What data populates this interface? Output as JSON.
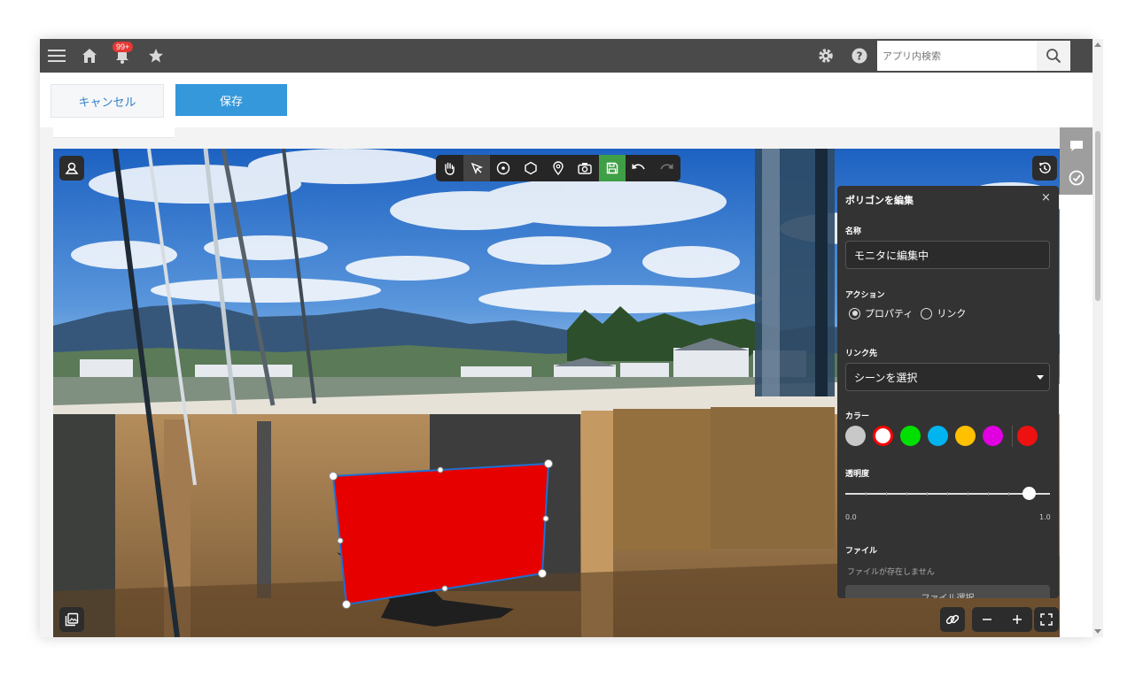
{
  "header": {
    "notification_badge": "99+",
    "search": {
      "placeholder": "アプリ内検索",
      "value": ""
    }
  },
  "actions": {
    "cancel_label": "キャンセル",
    "save_label": "保存"
  },
  "toolbar": {
    "tools": [
      "hand-icon",
      "pointer-icon",
      "circle-target-icon",
      "hexagon-icon",
      "location-pin-icon",
      "camera-icon",
      "save-icon",
      "undo-icon",
      "redo-icon"
    ],
    "active_tool": "pointer-icon"
  },
  "panel": {
    "title": "ポリゴンを編集",
    "close_label": "×",
    "name_label": "名称",
    "name_value": "モニタに編集中",
    "action_label": "アクション",
    "action_options": [
      "プロパティ",
      "リンク"
    ],
    "action_selected": "プロパティ",
    "link_label": "リンク先",
    "link_select_value": "シーンを選択",
    "color_label": "カラー",
    "colors": [
      "#c8c8c8",
      "#ff0000",
      "#00e000",
      "#00b4f0",
      "#ffc000",
      "#e000e0"
    ],
    "selected_color": "#ff0000",
    "current_color": "#ee1111",
    "opacity_label": "透明度",
    "opacity_value": 0.9,
    "opacity_min": "0.0",
    "opacity_max": "1.0",
    "file_label": "ファイル",
    "file_empty": "ファイルが存在しません",
    "file_button": "ファイル選択"
  },
  "polygon": {
    "fill": "#e60000"
  }
}
